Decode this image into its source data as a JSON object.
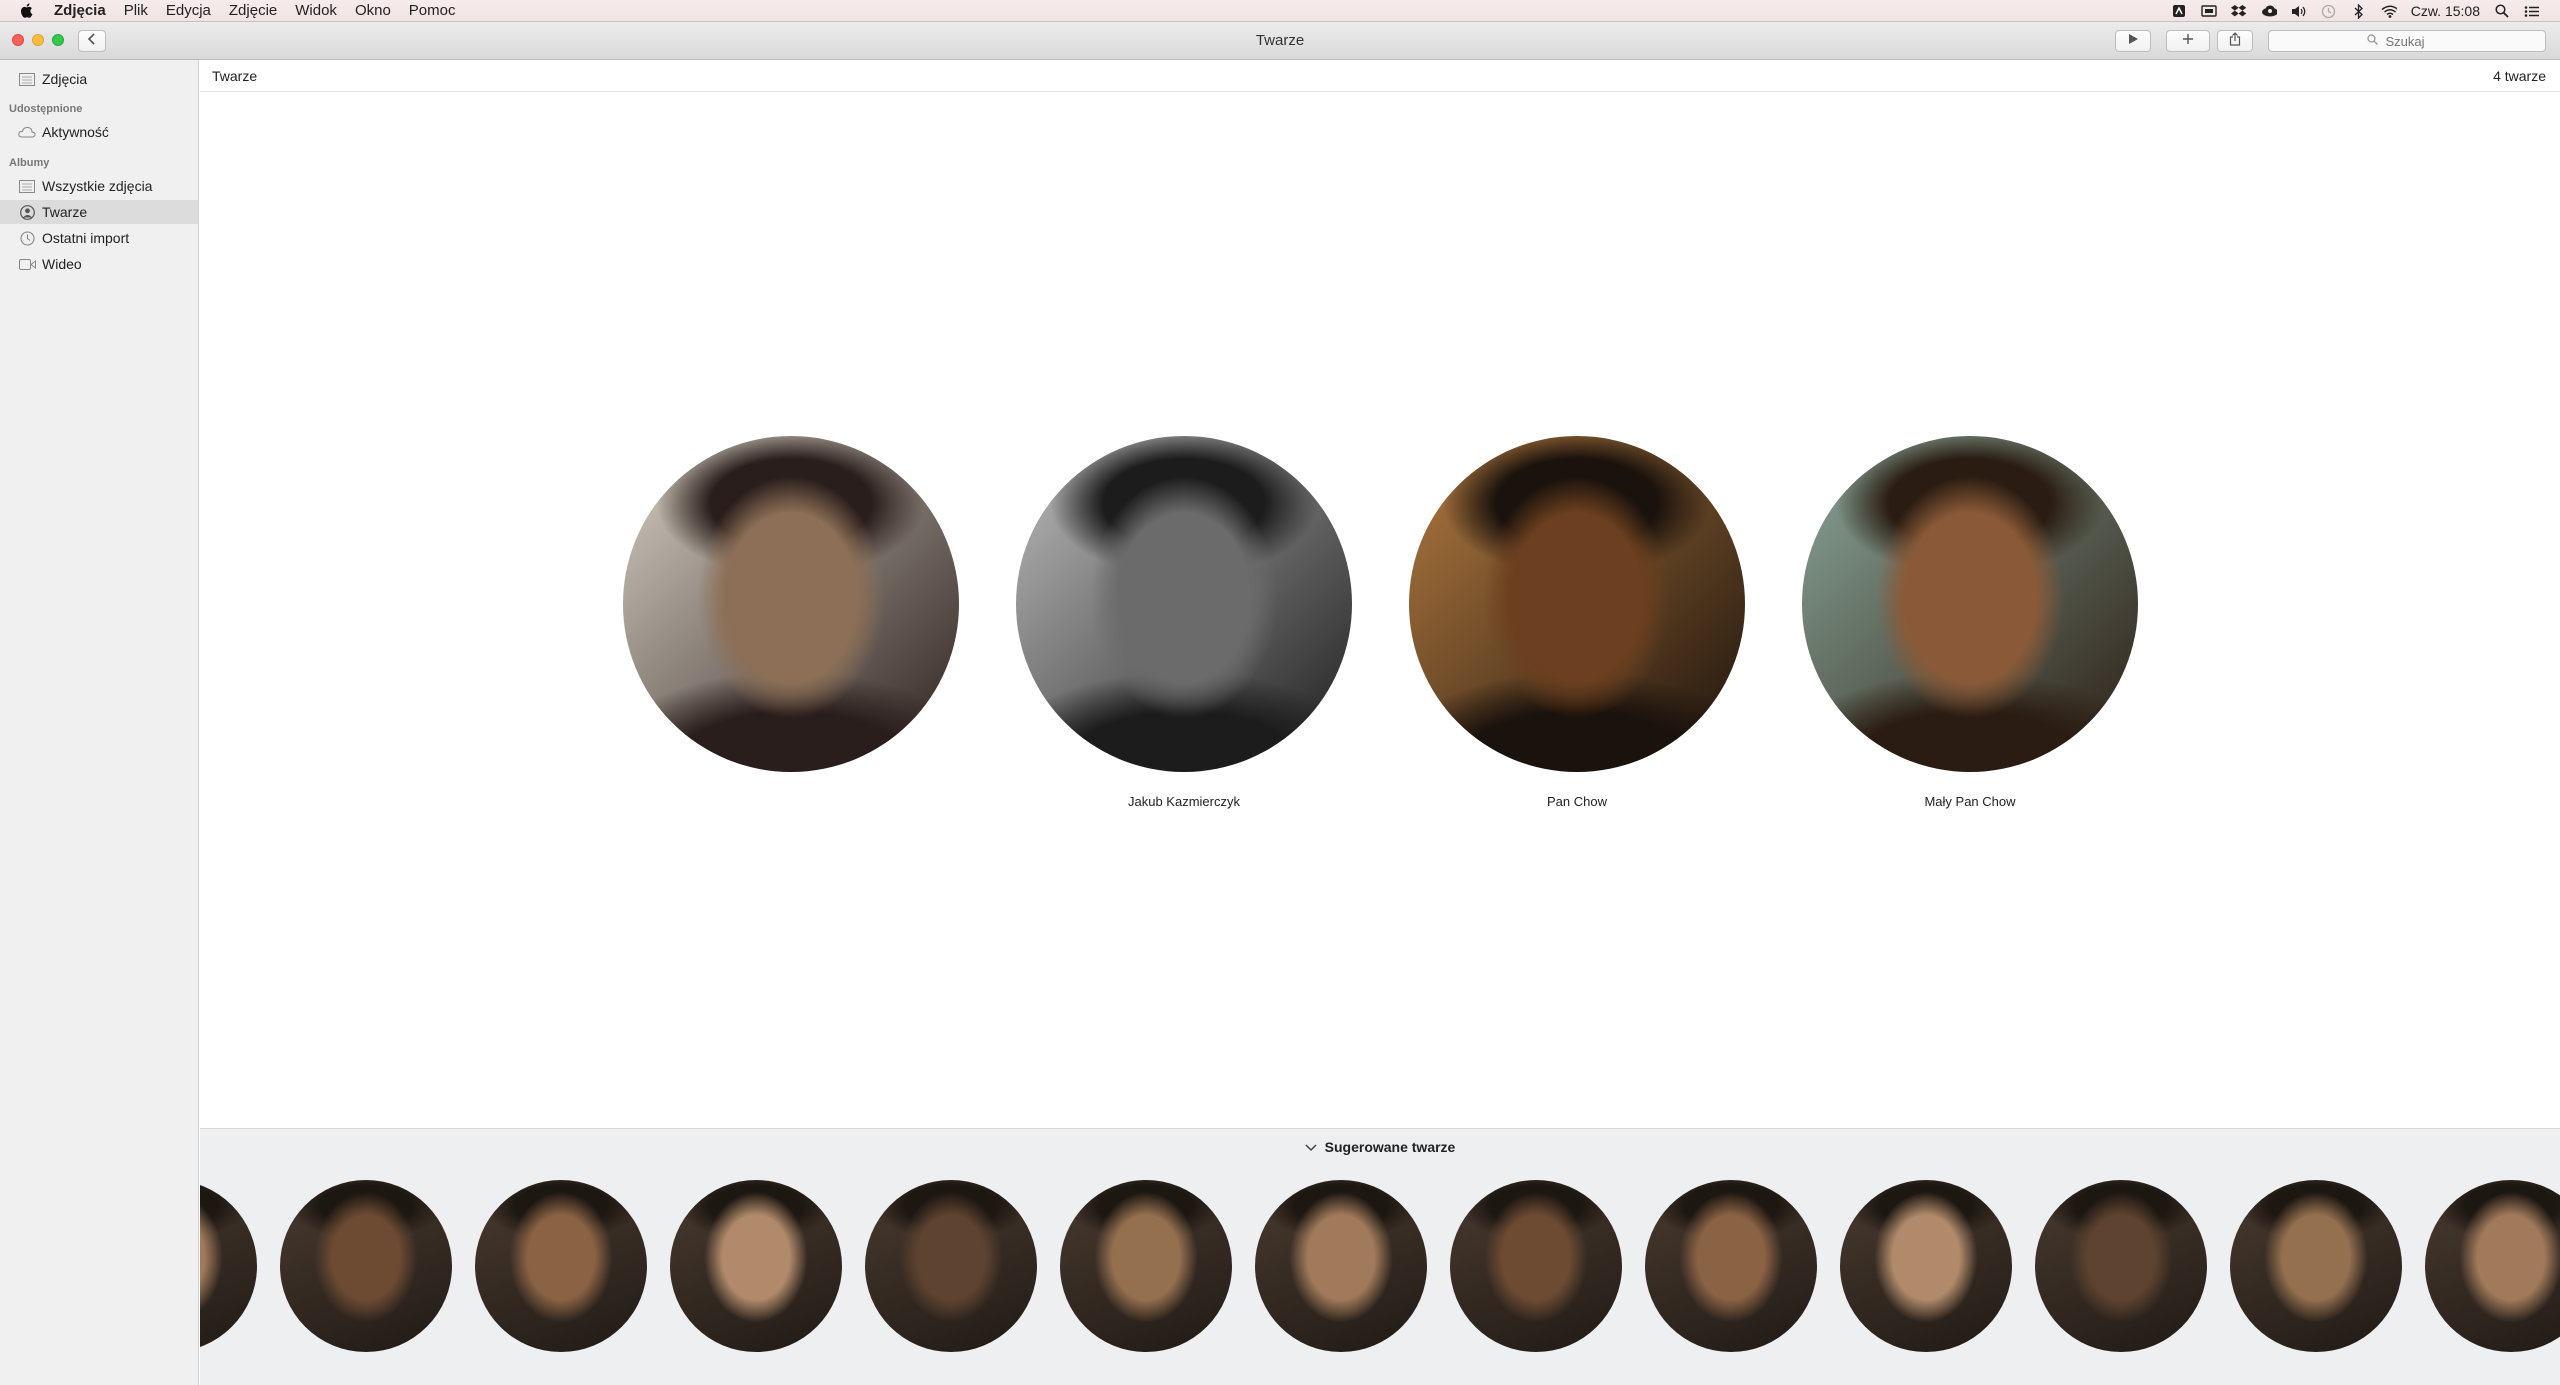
{
  "menubar": {
    "app_name": "Zdjęcia",
    "items": [
      "Plik",
      "Edycja",
      "Zdjęcie",
      "Widok",
      "Okno",
      "Pomoc"
    ],
    "clock": "Czw. 15:08",
    "status_icons": [
      "menu-app-icon",
      "screen-icon",
      "dropbox-icon",
      "cloud-icon",
      "volume-icon",
      "time-machine-icon",
      "bluetooth-icon",
      "wifi-icon",
      "spotlight-icon",
      "notification-list-icon"
    ]
  },
  "window": {
    "title": "Twarze",
    "search_placeholder": "Szukaj"
  },
  "sidebar": {
    "top_item": "Zdjęcia",
    "shared_header": "Udostępnione",
    "shared_items": [
      "Aktywność"
    ],
    "albums_header": "Albumy",
    "album_items": [
      "Wszystkie zdjęcia",
      "Twarze",
      "Ostatni import",
      "Wideo"
    ],
    "selected": "Twarze"
  },
  "content": {
    "title": "Twarze",
    "count_label": "4 twarze",
    "faces": [
      {
        "name": "",
        "palette": [
          "#d7d0c4",
          "#8c6f56",
          "#2a1e1c"
        ]
      },
      {
        "name": "Jakub Kazmierczyk",
        "palette": [
          "#bdbdbd",
          "#6b6b6b",
          "#1c1c1c"
        ]
      },
      {
        "name": "Pan Chow",
        "palette": [
          "#b27a40",
          "#6b3f1f",
          "#1a120c"
        ]
      },
      {
        "name": "Mały Pan Chow",
        "palette": [
          "#8ba79a",
          "#8a5a38",
          "#2a1c12"
        ]
      }
    ],
    "suggested_title": "Sugerowane twarze",
    "suggested_faces": 13
  }
}
